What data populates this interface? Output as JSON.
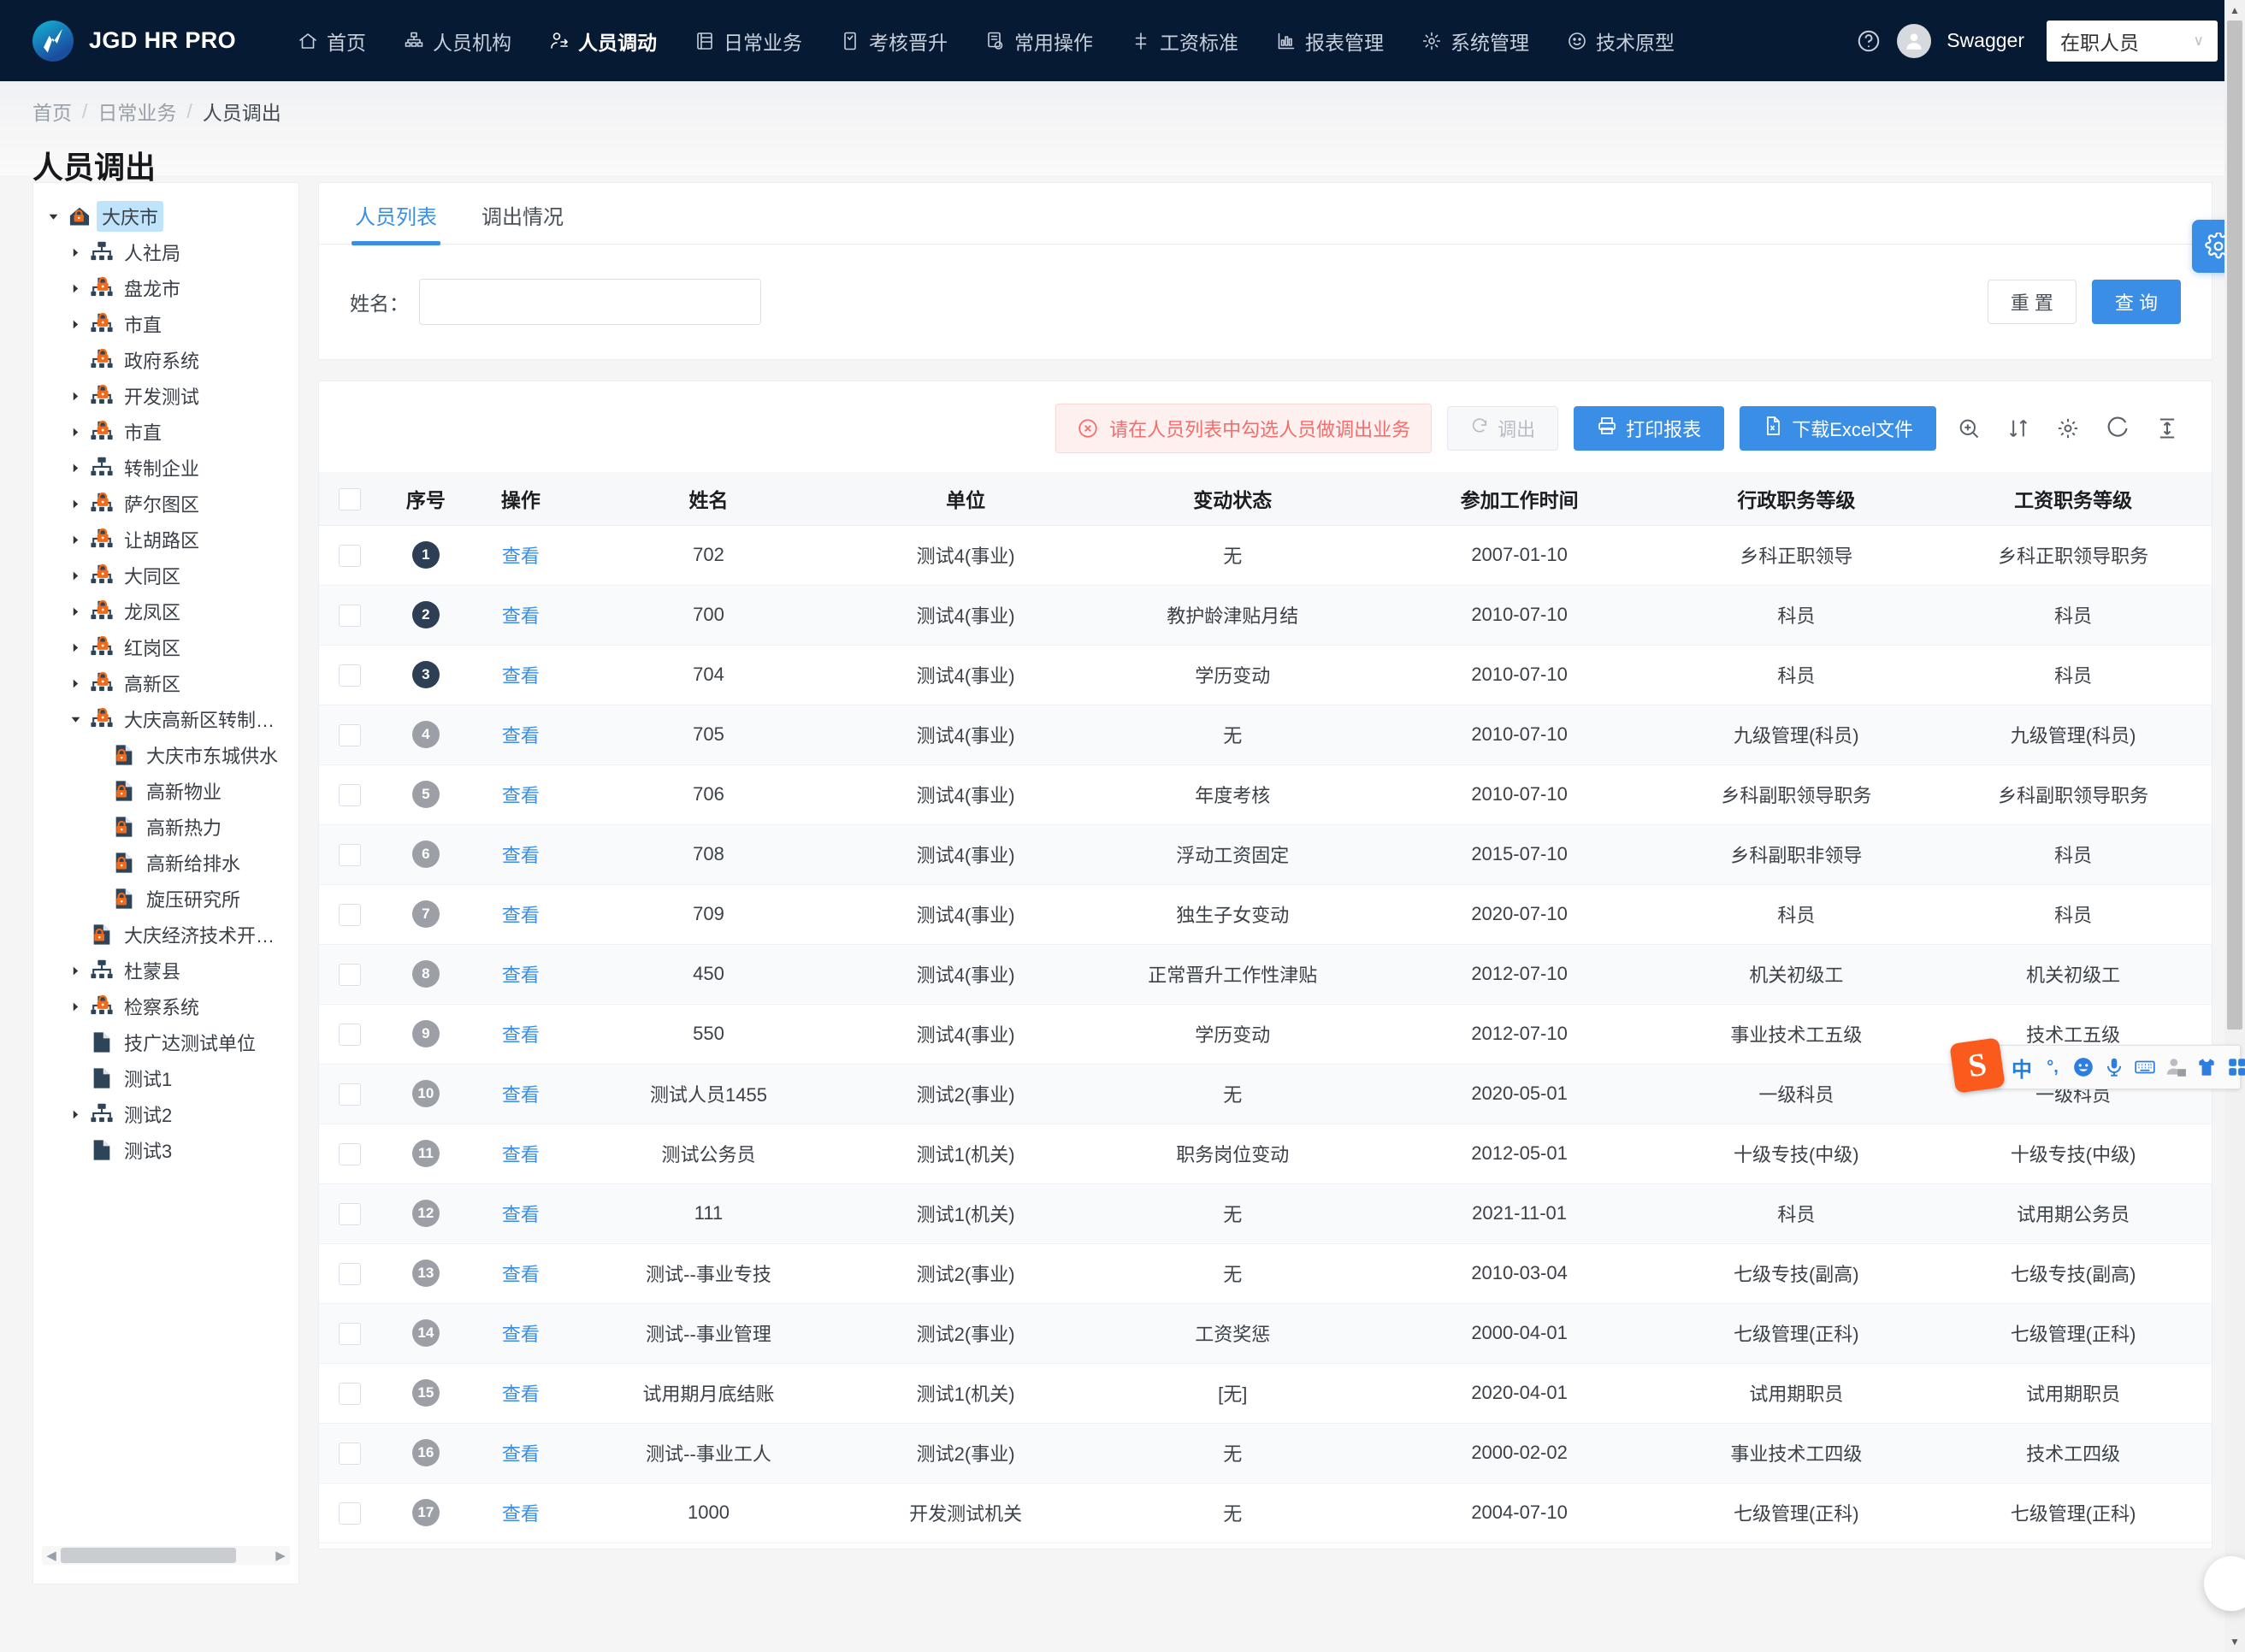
{
  "app": {
    "brand": "JGD HR PRO",
    "nav": [
      {
        "label": "首页",
        "icon": "home-icon",
        "active": false
      },
      {
        "label": "人员机构",
        "icon": "org-icon",
        "active": false
      },
      {
        "label": "人员调动",
        "icon": "user-transfer-icon",
        "active": true
      },
      {
        "label": "日常业务",
        "icon": "list-icon",
        "active": false
      },
      {
        "label": "考核晋升",
        "icon": "assess-icon",
        "active": false
      },
      {
        "label": "常用操作",
        "icon": "ops-icon",
        "active": false
      },
      {
        "label": "工资标准",
        "icon": "salary-icon",
        "active": false
      },
      {
        "label": "报表管理",
        "icon": "report-icon",
        "active": false
      },
      {
        "label": "系统管理",
        "icon": "gear-icon",
        "active": false
      },
      {
        "label": "技术原型",
        "icon": "smiley-icon",
        "active": false
      }
    ],
    "help_icon": "help-circle-icon",
    "username": "Swagger",
    "job_status": "在职人员"
  },
  "breadcrumb": {
    "items": [
      "首页",
      "日常业务",
      "人员调出"
    ],
    "separator": "/"
  },
  "page_title": "人员调出",
  "tree": {
    "nodes": [
      {
        "label": "大庆市",
        "depth": 0,
        "arrow": "down",
        "icon": "home-lock-icon",
        "selected": true
      },
      {
        "label": "人社局",
        "depth": 1,
        "arrow": "right",
        "icon": "org-icon",
        "selected": false
      },
      {
        "label": "盘龙市",
        "depth": 1,
        "arrow": "right",
        "icon": "org-lock-icon",
        "selected": false
      },
      {
        "label": "市直",
        "depth": 1,
        "arrow": "right",
        "icon": "org-lock-icon",
        "selected": false
      },
      {
        "label": "政府系统",
        "depth": 1,
        "arrow": "none",
        "icon": "org-lock-icon",
        "selected": false
      },
      {
        "label": "开发测试",
        "depth": 1,
        "arrow": "right",
        "icon": "org-lock-icon",
        "selected": false
      },
      {
        "label": "市直",
        "depth": 1,
        "arrow": "right",
        "icon": "org-lock-icon",
        "selected": false
      },
      {
        "label": "转制企业",
        "depth": 1,
        "arrow": "right",
        "icon": "org-icon",
        "selected": false
      },
      {
        "label": "萨尔图区",
        "depth": 1,
        "arrow": "right",
        "icon": "org-lock-icon",
        "selected": false
      },
      {
        "label": "让胡路区",
        "depth": 1,
        "arrow": "right",
        "icon": "org-lock-icon",
        "selected": false
      },
      {
        "label": "大同区",
        "depth": 1,
        "arrow": "right",
        "icon": "org-lock-icon",
        "selected": false
      },
      {
        "label": "龙凤区",
        "depth": 1,
        "arrow": "right",
        "icon": "org-lock-icon",
        "selected": false
      },
      {
        "label": "红岗区",
        "depth": 1,
        "arrow": "right",
        "icon": "org-lock-icon",
        "selected": false
      },
      {
        "label": "高新区",
        "depth": 1,
        "arrow": "right",
        "icon": "org-lock-icon",
        "selected": false
      },
      {
        "label": "大庆高新区转制单位",
        "depth": 1,
        "arrow": "down",
        "icon": "org-lock-icon",
        "selected": false
      },
      {
        "label": "大庆市东城供水",
        "depth": 2,
        "arrow": "none",
        "icon": "file-lock-icon",
        "selected": false
      },
      {
        "label": "高新物业",
        "depth": 2,
        "arrow": "none",
        "icon": "file-lock-icon",
        "selected": false
      },
      {
        "label": "高新热力",
        "depth": 2,
        "arrow": "none",
        "icon": "file-lock-icon",
        "selected": false
      },
      {
        "label": "高新给排水",
        "depth": 2,
        "arrow": "none",
        "icon": "file-lock-icon",
        "selected": false
      },
      {
        "label": "旋压研究所",
        "depth": 2,
        "arrow": "none",
        "icon": "file-lock-icon",
        "selected": false
      },
      {
        "label": "大庆经济技术开发区",
        "depth": 1,
        "arrow": "none",
        "icon": "file-lock-icon",
        "selected": false
      },
      {
        "label": "杜蒙县",
        "depth": 1,
        "arrow": "right",
        "icon": "org-icon",
        "selected": false
      },
      {
        "label": "检察系统",
        "depth": 1,
        "arrow": "right",
        "icon": "org-lock-icon",
        "selected": false
      },
      {
        "label": "技广达测试单位",
        "depth": 1,
        "arrow": "none",
        "icon": "file-icon",
        "selected": false
      },
      {
        "label": "测试1",
        "depth": 1,
        "arrow": "none",
        "icon": "file-icon",
        "selected": false
      },
      {
        "label": "测试2",
        "depth": 1,
        "arrow": "right",
        "icon": "org-icon",
        "selected": false
      },
      {
        "label": "测试3",
        "depth": 1,
        "arrow": "none",
        "icon": "file-icon",
        "selected": false
      }
    ]
  },
  "tabs": [
    {
      "label": "人员列表",
      "active": true
    },
    {
      "label": "调出情况",
      "active": false
    }
  ],
  "filter": {
    "name_label": "姓名：",
    "name_value": "",
    "name_placeholder": "",
    "reset_label": "重 置",
    "query_label": "查 询",
    "settings_icon": "gear-icon"
  },
  "toolbar": {
    "alert_text": "请在人员列表中勾选人员做调出业务",
    "alert_icon": "error-circle-icon",
    "transfer_out_label": "调出",
    "transfer_out_icon": "refresh-icon",
    "print_label": "打印报表",
    "print_icon": "printer-icon",
    "excel_label": "下载Excel文件",
    "excel_icon": "file-excel-icon",
    "icons": [
      "zoom-in-icon",
      "sort-icon",
      "gear-icon",
      "refresh-icon",
      "column-height-icon"
    ]
  },
  "table": {
    "columns": [
      "序号",
      "操作",
      "姓名",
      "单位",
      "变动状态",
      "参加工作时间",
      "行政职务等级",
      "工资职务等级"
    ],
    "view_label": "查看",
    "rows": [
      {
        "idx": "1",
        "dark": true,
        "name": "702",
        "unit": "测试4(事业)",
        "status": "无",
        "work_date": "2007-01-10",
        "admin_grade": "乡科正职领导",
        "pay_grade": "乡科正职领导职务"
      },
      {
        "idx": "2",
        "dark": true,
        "name": "700",
        "unit": "测试4(事业)",
        "status": "教护龄津贴月结",
        "work_date": "2010-07-10",
        "admin_grade": "科员",
        "pay_grade": "科员"
      },
      {
        "idx": "3",
        "dark": true,
        "name": "704",
        "unit": "测试4(事业)",
        "status": "学历变动",
        "work_date": "2010-07-10",
        "admin_grade": "科员",
        "pay_grade": "科员"
      },
      {
        "idx": "4",
        "dark": false,
        "name": "705",
        "unit": "测试4(事业)",
        "status": "无",
        "work_date": "2010-07-10",
        "admin_grade": "九级管理(科员)",
        "pay_grade": "九级管理(科员)"
      },
      {
        "idx": "5",
        "dark": false,
        "name": "706",
        "unit": "测试4(事业)",
        "status": "年度考核",
        "work_date": "2010-07-10",
        "admin_grade": "乡科副职领导职务",
        "pay_grade": "乡科副职领导职务"
      },
      {
        "idx": "6",
        "dark": false,
        "name": "708",
        "unit": "测试4(事业)",
        "status": "浮动工资固定",
        "work_date": "2015-07-10",
        "admin_grade": "乡科副职非领导",
        "pay_grade": "科员"
      },
      {
        "idx": "7",
        "dark": false,
        "name": "709",
        "unit": "测试4(事业)",
        "status": "独生子女变动",
        "work_date": "2020-07-10",
        "admin_grade": "科员",
        "pay_grade": "科员"
      },
      {
        "idx": "8",
        "dark": false,
        "name": "450",
        "unit": "测试4(事业)",
        "status": "正常晋升工作性津贴",
        "work_date": "2012-07-10",
        "admin_grade": "机关初级工",
        "pay_grade": "机关初级工"
      },
      {
        "idx": "9",
        "dark": false,
        "name": "550",
        "unit": "测试4(事业)",
        "status": "学历变动",
        "work_date": "2012-07-10",
        "admin_grade": "事业技术工五级",
        "pay_grade": "技术工五级"
      },
      {
        "idx": "10",
        "dark": false,
        "name": "测试人员1455",
        "unit": "测试2(事业)",
        "status": "无",
        "work_date": "2020-05-01",
        "admin_grade": "一级科员",
        "pay_grade": "一级科员"
      },
      {
        "idx": "11",
        "dark": false,
        "name": "测试公务员",
        "unit": "测试1(机关)",
        "status": "职务岗位变动",
        "work_date": "2012-05-01",
        "admin_grade": "十级专技(中级)",
        "pay_grade": "十级专技(中级)"
      },
      {
        "idx": "12",
        "dark": false,
        "name": "111",
        "unit": "测试1(机关)",
        "status": "无",
        "work_date": "2021-11-01",
        "admin_grade": "科员",
        "pay_grade": "试用期公务员"
      },
      {
        "idx": "13",
        "dark": false,
        "name": "测试--事业专技",
        "unit": "测试2(事业)",
        "status": "无",
        "work_date": "2010-03-04",
        "admin_grade": "七级专技(副高)",
        "pay_grade": "七级专技(副高)"
      },
      {
        "idx": "14",
        "dark": false,
        "name": "测试--事业管理",
        "unit": "测试2(事业)",
        "status": "工资奖惩",
        "work_date": "2000-04-01",
        "admin_grade": "七级管理(正科)",
        "pay_grade": "七级管理(正科)"
      },
      {
        "idx": "15",
        "dark": false,
        "name": "试用期月底结账",
        "unit": "测试1(机关)",
        "status": "[无]",
        "work_date": "2020-04-01",
        "admin_grade": "试用期职员",
        "pay_grade": "试用期职员"
      },
      {
        "idx": "16",
        "dark": false,
        "name": "测试--事业工人",
        "unit": "测试2(事业)",
        "status": "无",
        "work_date": "2000-02-02",
        "admin_grade": "事业技术工四级",
        "pay_grade": "技术工四级"
      },
      {
        "idx": "17",
        "dark": false,
        "name": "1000",
        "unit": "开发测试机关",
        "status": "无",
        "work_date": "2004-07-10",
        "admin_grade": "七级管理(正科)",
        "pay_grade": "七级管理(正科)"
      }
    ]
  },
  "ime": {
    "logo": "S",
    "items": [
      {
        "name": "language-mode",
        "glyph": "中"
      },
      {
        "name": "punctuation-mode",
        "glyph": "°,"
      },
      {
        "name": "emoji-icon",
        "glyph": ""
      },
      {
        "name": "voice-input-icon",
        "glyph": ""
      },
      {
        "name": "soft-keyboard-icon",
        "glyph": ""
      },
      {
        "name": "user-badge-icon",
        "glyph": "19"
      },
      {
        "name": "skin-icon",
        "glyph": ""
      },
      {
        "name": "toolbox-icon",
        "glyph": ""
      }
    ]
  },
  "colors": {
    "brand_dark": "#071a33",
    "accent": "#3a8ee6",
    "danger": "#f56c6c",
    "lock_orange": "#f06a19",
    "tree_navy": "#2e4459"
  }
}
